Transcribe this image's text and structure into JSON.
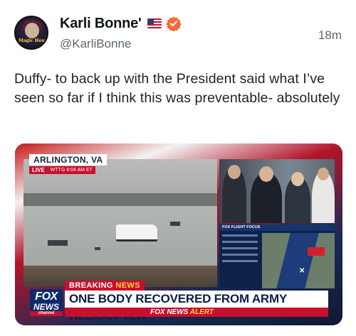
{
  "author": {
    "display_name": "Karli Bonne'",
    "handle": "@KarliBonne",
    "timestamp": "18m",
    "avatar_text": "Magic Hour",
    "flag_icon": "us-flag-icon",
    "verified_icon": "verified-badge-icon",
    "verified_color": "#f26b3a"
  },
  "post": {
    "text": "Duffy- to back up with the President said what I’ve seen so far if I think this was preventable- absolutely"
  },
  "media": {
    "location": "ARLINGTON, VA",
    "live_label": "LIVE",
    "live_meta": "WTTG  8:04 AM ET",
    "map_header": "FOX FLIGHT FOCUS",
    "breaking_label": "BREAKING",
    "breaking_label_2": "NEWS",
    "logo_fox": "FOX",
    "logo_news": "NEWS",
    "logo_channel": "channel",
    "headline": "ONE BODY RECOVERED FROM ARMY HELICOPTER",
    "alert_prefix": "FOX NEWS",
    "alert_word": "ALERT",
    "colors": {
      "fox_red": "#c8102e",
      "fox_blue": "#0d2a6b",
      "alert_yellow": "#ffd23f"
    }
  }
}
